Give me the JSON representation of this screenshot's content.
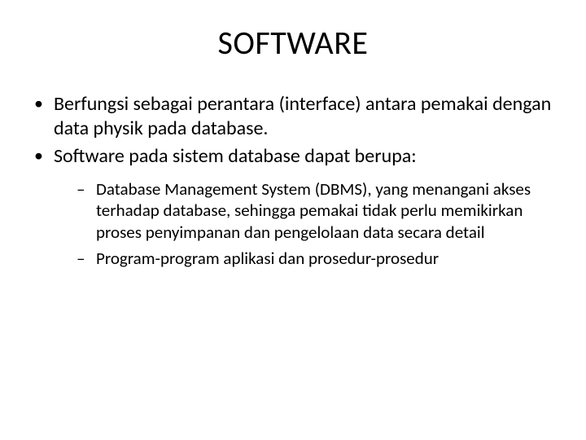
{
  "title": "SOFTWARE",
  "bullets": {
    "b1": "Berfungsi sebagai perantara (interface) antara pemakai dengan data physik pada database.",
    "b2": "Software pada sistem database dapat berupa:",
    "sub": {
      "s1": "Database Management System (DBMS), yang menangani akses terhadap database, sehingga pemakai tidak perlu memikirkan proses penyimpanan dan pengelolaan data secara detail",
      "s2": "Program-program aplikasi dan prosedur-prosedur"
    }
  }
}
